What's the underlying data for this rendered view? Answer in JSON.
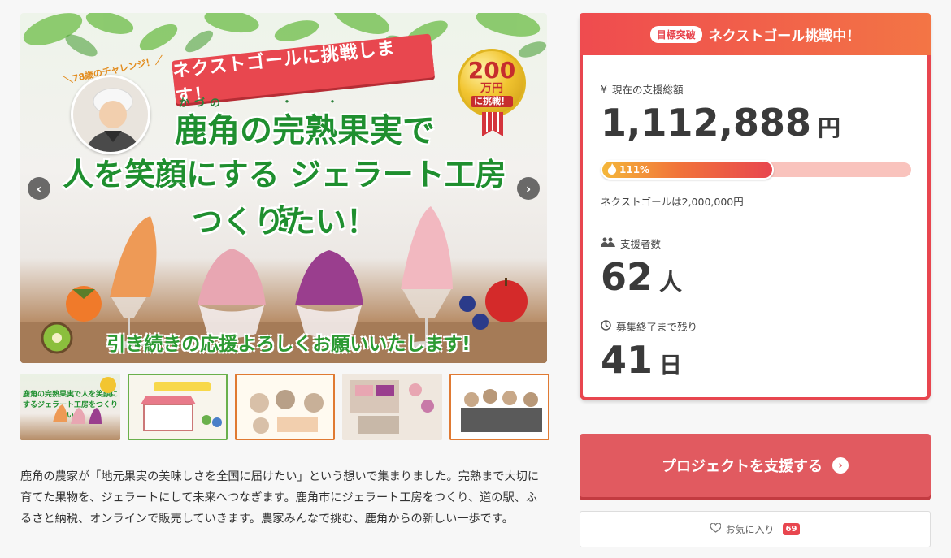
{
  "hero": {
    "ribbon_text": "ネクストゴールに挑戦します！",
    "challenge_tag": "＼78歳のチャレンジ！／",
    "ruby_text": "かづの",
    "headline_line1": "鹿角の完熟果実で",
    "headline_line2": "人を笑顔にする ジェラート工房を",
    "headline_line3": "つくりたい！",
    "medal_amount": "200",
    "medal_unit": "万円",
    "medal_challenge": "に挑戦！",
    "bottom_banner": "引き続きの応援よろしくお願いいたします!",
    "prev_arrow": "‹",
    "next_arrow": "›"
  },
  "thumbnails": [
    {
      "title": "鹿角の完熟果実で人を笑顔にするジェラート工房をつくりたい！"
    },
    {
      "title": ""
    },
    {
      "title": ""
    },
    {
      "title": ""
    },
    {
      "title": ""
    }
  ],
  "description": "鹿角の農家が「地元果実の美味しさを全国に届けたい」という想いで集まりました。完熟まで大切に育てた果物を、ジェラートにして未来へつなぎます。鹿角市にジェラート工房をつくり、道の駅、ふるさと納税、オンラインで販売していきます。農家みんなで挑む、鹿角からの新しい一歩です。",
  "stats": {
    "header_badge": "目標突破",
    "header_title": "ネクストゴール挑戦中！",
    "amount_label": "現在の支援総額",
    "amount_icon": "yen-icon",
    "amount_value": "1,112,888",
    "amount_unit": "円",
    "progress_percent": 111,
    "progress_label": "111%",
    "next_goal_text": "ネクストゴールは2,000,000円",
    "backers_label": "支援者数",
    "backers_value": "62",
    "backers_unit": "人",
    "remaining_label": "募集終了まで残り",
    "remaining_value": "41",
    "remaining_unit": "日"
  },
  "actions": {
    "support_label": "プロジェクトを支援する",
    "favorite_label": "お気に入り",
    "favorite_count": "69"
  },
  "colors": {
    "accent": "#e8464f",
    "button": "#e15a60",
    "headline_green": "#1f8f2f"
  }
}
